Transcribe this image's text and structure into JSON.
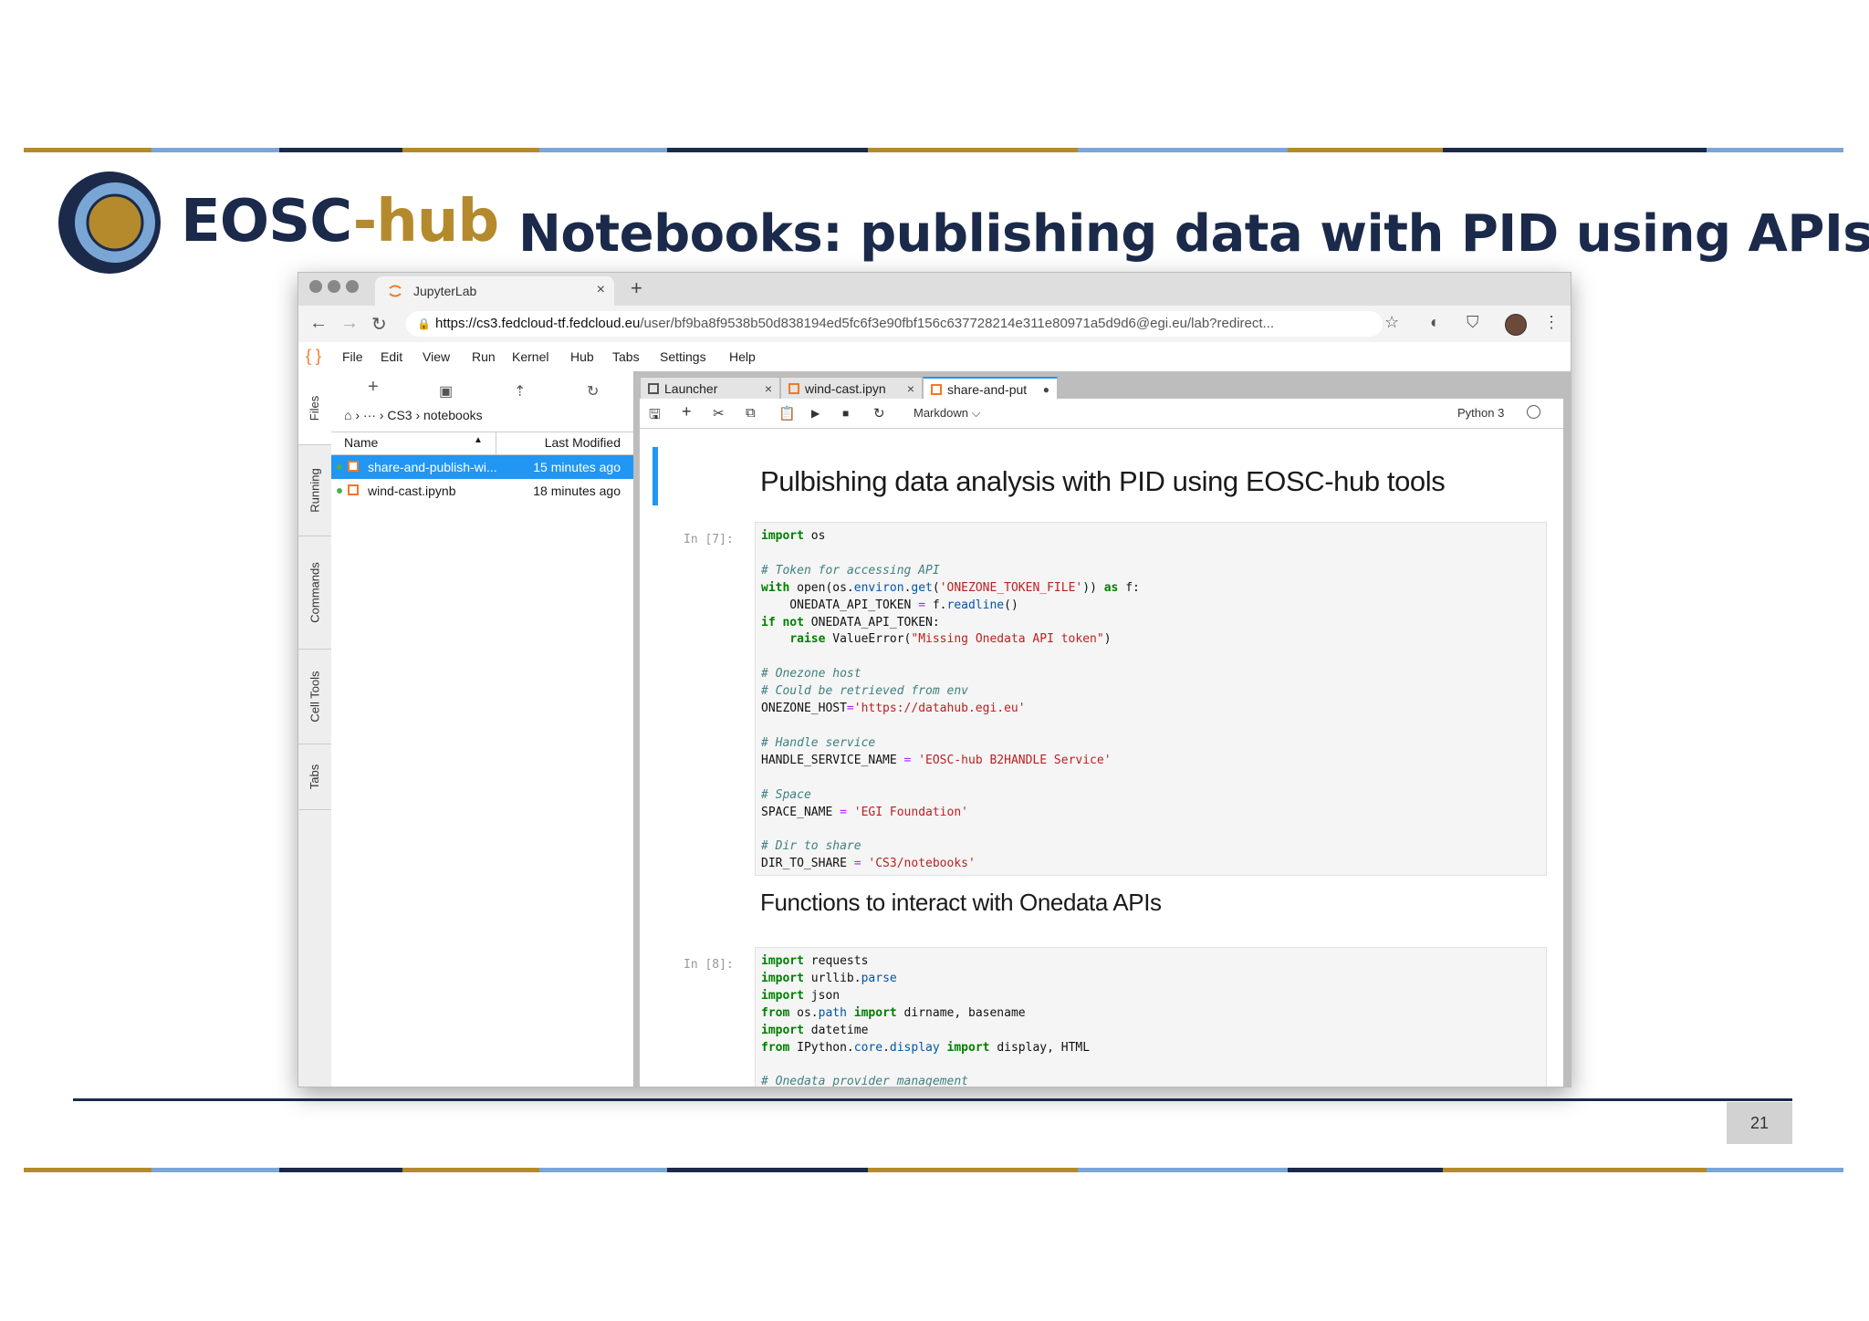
{
  "slide": {
    "logo_text_main": "EOSC",
    "logo_text_accent": "-hub",
    "title": "Notebooks: publishing data with PID using APIs",
    "page_number": "21"
  },
  "colors": {
    "navy": "#1b2a4a",
    "gold": "#b48a2c",
    "light_blue": "#7aa6d6",
    "jupyter_orange": "#f37726",
    "selection_blue": "#2196f3"
  },
  "browser": {
    "tab_title": "JupyterLab",
    "tab_close": "×",
    "new_tab": "+",
    "url_host": "https://cs3.fedcloud-tf.fedcloud.eu",
    "url_path": "/user/bf9ba8f9538b50d838194ed5fc6f3e90fbf156c637728214e311e80971a5d9d6@egi.eu/lab?redirect..."
  },
  "jupyter": {
    "menu": [
      "File",
      "Edit",
      "View",
      "Run",
      "Kernel",
      "Hub",
      "Tabs",
      "Settings",
      "Help"
    ],
    "side_tabs": [
      "Files",
      "Running",
      "Commands",
      "Cell Tools",
      "Tabs"
    ],
    "file_browser": {
      "breadcrumb_root": "⌂",
      "breadcrumb_ellipsis": "› ··· ›",
      "breadcrumb_path": "CS3 › notebooks",
      "col_name": "Name",
      "col_modified": "Last Modified",
      "sort_indicator": "▲",
      "files": [
        {
          "name": "share-and-publish-wi...",
          "modified": "15 minutes ago",
          "selected": true
        },
        {
          "name": "wind-cast.ipynb",
          "modified": "18 minutes ago",
          "selected": false
        }
      ]
    },
    "doc_tabs": [
      {
        "label": "Launcher",
        "close": "×"
      },
      {
        "label": "wind-cast.ipyn",
        "close": "×"
      },
      {
        "label": "share-and-put",
        "close": "●"
      }
    ],
    "toolbar": {
      "cell_type": "Markdown ⌵",
      "kernel_name": "Python 3"
    },
    "notebook": {
      "heading1": "Pulbishing data analysis with PID using EOSC-hub tools",
      "prompt1": "In [7]:",
      "heading2": "Functions to interact with Onedata APIs",
      "prompt2": "In [8]:"
    }
  }
}
